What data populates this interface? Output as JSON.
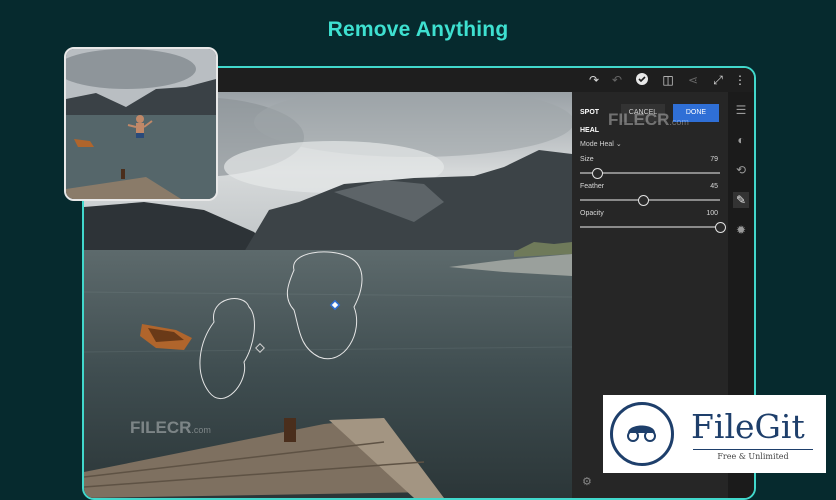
{
  "headline": "Remove Anything",
  "toolbar": {
    "icons": [
      "redo-icon",
      "undo-icon",
      "check-icon",
      "compare-icon",
      "share-icon",
      "fullscreen-icon",
      "more-icon"
    ]
  },
  "panel": {
    "tab_spot_heal": "SPOT HEAL",
    "cancel_label": "CANCEL",
    "done_label": "DONE",
    "mode_label": "Mode Heal",
    "sliders": [
      {
        "label": "Size",
        "value": "79",
        "level": 0.12
      },
      {
        "label": "Feather",
        "value": "45",
        "level": 0.45
      },
      {
        "label": "Opacity",
        "value": "100",
        "level": 1.0
      }
    ]
  },
  "watermarks": {
    "top": "FILECR",
    "top_sub": ".com",
    "bottom": "FILECR",
    "bottom_sub": ".com"
  },
  "badge": {
    "name": "FileGit",
    "tagline": "Free & Unlimited"
  },
  "colors": {
    "accent": "#41d8cc",
    "done": "#2f6fd6",
    "brand": "#1e3f6b"
  }
}
